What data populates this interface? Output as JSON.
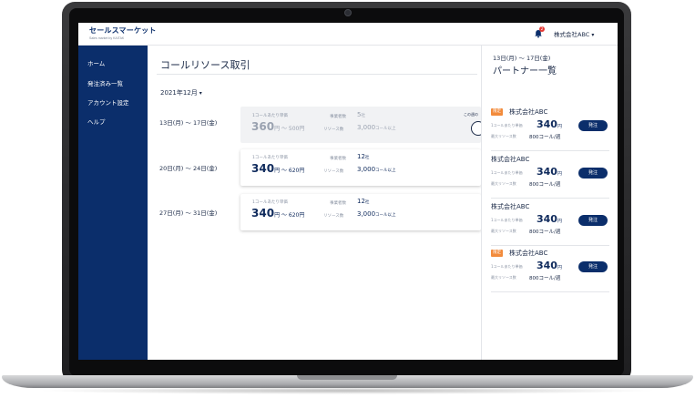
{
  "app": {
    "logo_main": "セールスマーケット",
    "logo_sub": "Sales market by KAITAK",
    "notification_count": "2",
    "company_menu_label": "株式会社ABC"
  },
  "sidebar": {
    "items": [
      {
        "label": "ホーム"
      },
      {
        "label": "発注済み一覧"
      },
      {
        "label": "アカウント設定"
      },
      {
        "label": "ヘルプ"
      }
    ]
  },
  "main": {
    "title": "コールリソース取引",
    "month_selector": "2021年12月",
    "toggle_label": "この週の",
    "weeks": [
      {
        "range": "13日(月) 〜 17日(金)",
        "unit_price_label": "1コールあたり単価",
        "price_main": "360",
        "price_suffix": "円 〜 500円",
        "firms_label": "事業者数",
        "firms_value": "5",
        "firms_unit": "社",
        "resource_label": "リソース数",
        "resource_value": "3,000",
        "resource_unit": "コール以上"
      },
      {
        "range": "20日(月) 〜 24日(金)",
        "unit_price_label": "1コールあたり単価",
        "price_main": "340",
        "price_suffix": "円 〜 620円",
        "firms_label": "事業者数",
        "firms_value": "12",
        "firms_unit": "社",
        "resource_label": "リソース数",
        "resource_value": "3,000",
        "resource_unit": "コール以上"
      },
      {
        "range": "27日(月) 〜 31日(金)",
        "unit_price_label": "1コールあたり単価",
        "price_main": "340",
        "price_suffix": "円 〜 620円",
        "firms_label": "事業者数",
        "firms_value": "12",
        "firms_unit": "社",
        "resource_label": "リソース数",
        "resource_value": "3,000",
        "resource_unit": "コール以上"
      }
    ]
  },
  "partners": {
    "date_range": "13日(月) 〜 17日(金)",
    "title": "パートナー一覧",
    "items": [
      {
        "tag": "限定",
        "name": "株式会社ABC",
        "price_label": "1コールあたり単価",
        "price": "340",
        "price_unit": "円",
        "capacity_label": "最大リソース数",
        "capacity": "800コール/週",
        "button": "発注"
      },
      {
        "tag": "",
        "name": "株式会社ABC",
        "price_label": "1コールあたり単価",
        "price": "340",
        "price_unit": "円",
        "capacity_label": "最大リソース数",
        "capacity": "800コール/週",
        "button": "発注"
      },
      {
        "tag": "",
        "name": "株式会社ABC",
        "price_label": "1コールあたり単価",
        "price": "340",
        "price_unit": "円",
        "capacity_label": "最大リソース数",
        "capacity": "800コール/週",
        "button": "発注"
      },
      {
        "tag": "限定",
        "name": "株式会社ABC",
        "price_label": "1コールあたり単価",
        "price": "340",
        "price_unit": "円",
        "capacity_label": "最大リソース数",
        "capacity": "800コール/週",
        "button": "発注"
      }
    ]
  },
  "colors": {
    "brand_navy": "#0b2e6b",
    "tag_orange": "#f28b3c",
    "badge_red": "#e53935"
  }
}
